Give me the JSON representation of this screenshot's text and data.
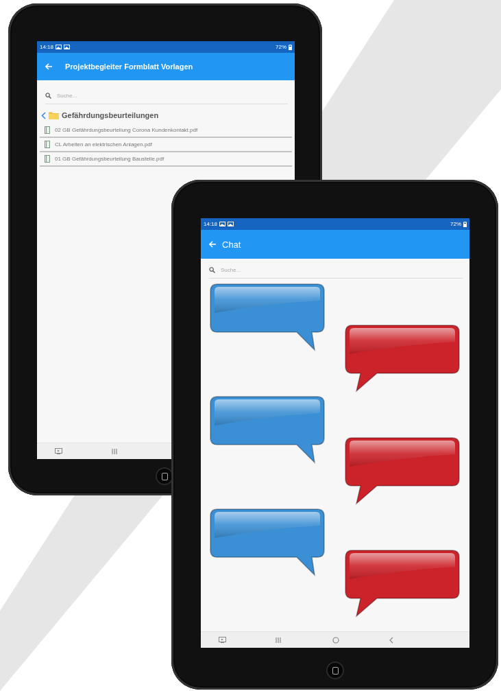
{
  "devices": [
    {
      "status_bar": {
        "time": "14:18",
        "battery": "72%"
      },
      "app_bar": {
        "title": "Projektbegleiter Formblatt Vorlagen"
      },
      "search": {
        "placeholder": "Suche..."
      },
      "folder": {
        "name": "Gefährdungsbeurteilungen"
      },
      "files": [
        {
          "name": "02 GB Gefährdungsbeurteilung Corona Kundenkontakt.pdf"
        },
        {
          "name": "CL Arbeiten an elektrischen Anlagen.pdf"
        },
        {
          "name": "01 GB Gefährdungsbeurteilung Baustelle.pdf"
        }
      ]
    },
    {
      "status_bar": {
        "time": "14:18",
        "battery": "72%"
      },
      "app_bar": {
        "title": "Chat"
      },
      "search": {
        "placeholder": "Suche..."
      },
      "messages": [
        {
          "kind": "incoming",
          "color": "#3b8fd4"
        },
        {
          "kind": "outgoing",
          "color": "#cc2229"
        },
        {
          "kind": "incoming",
          "color": "#3b8fd4"
        },
        {
          "kind": "outgoing",
          "color": "#cc2229"
        },
        {
          "kind": "incoming",
          "color": "#3b8fd4"
        },
        {
          "kind": "outgoing",
          "color": "#cc2229"
        }
      ]
    }
  ]
}
